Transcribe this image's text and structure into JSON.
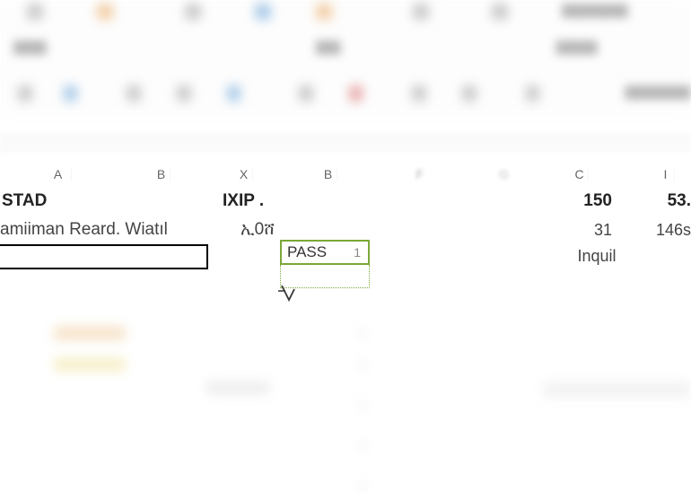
{
  "columns": {
    "A": "A",
    "B": "B",
    "X": "X",
    "BB": "B",
    "F": "F",
    "G": "G",
    "C": "C",
    "I": "I"
  },
  "headers": {
    "stad": "STAD",
    "ixip": "IXIP .",
    "c150": "150",
    "i53": "53."
  },
  "row2": {
    "name": "amiiman Reard. Wiatıl",
    "xval": "ኢ0ሸ",
    "c31": "31",
    "i146s": "146s"
  },
  "row3": {
    "inquil": "Inquil"
  },
  "active": {
    "value": "PASS",
    "suffix": "1"
  }
}
